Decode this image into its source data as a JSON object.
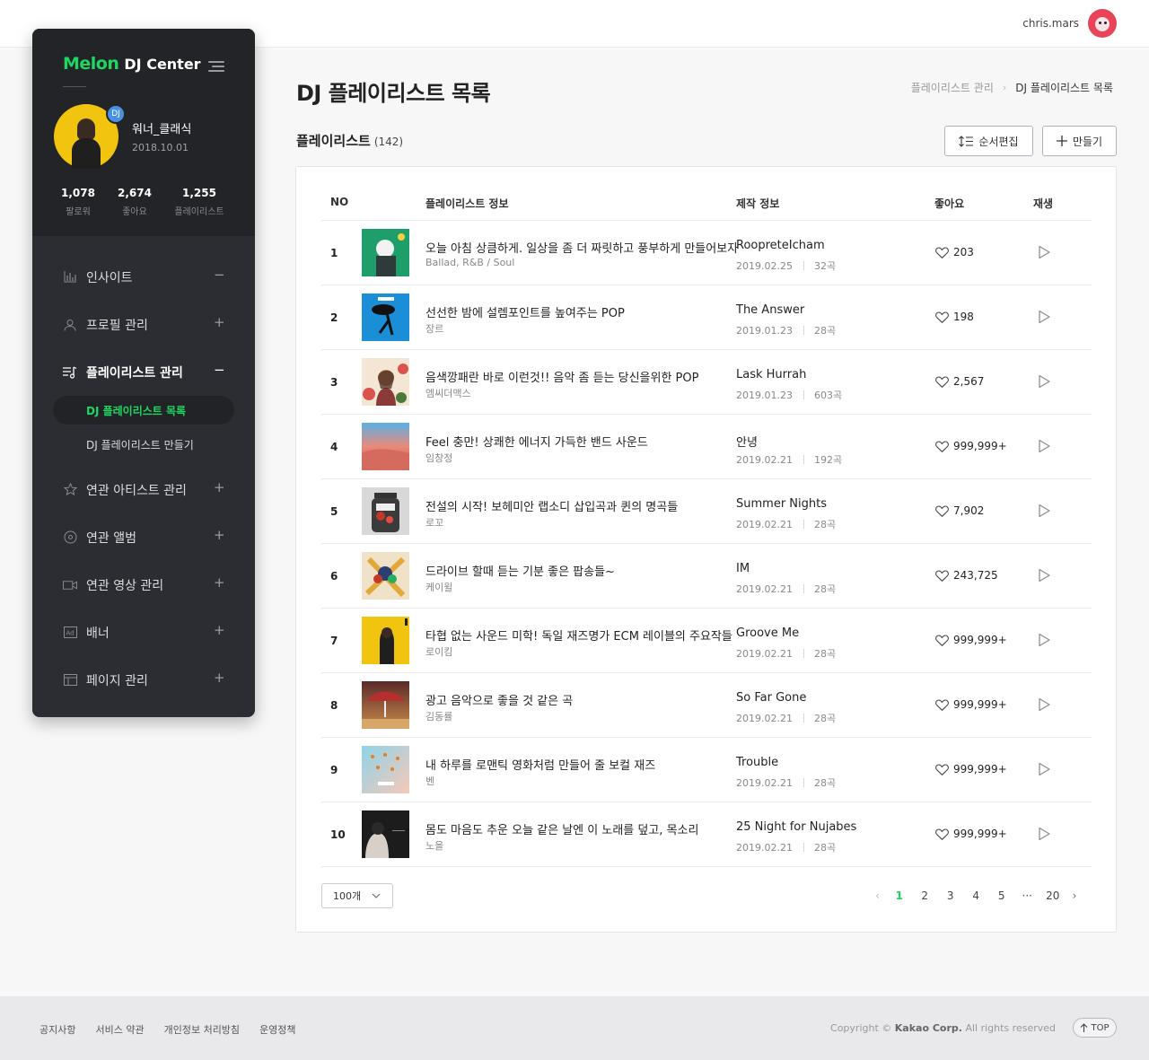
{
  "header": {
    "username": "chris.mars"
  },
  "sidebar": {
    "logo_brand": "Melon",
    "logo_product": "DJ Center",
    "profile": {
      "badge": "DJ",
      "name": "워너_클래식",
      "date": "2018.10.01"
    },
    "stats": [
      {
        "value": "1,078",
        "label": "팔로워"
      },
      {
        "value": "2,674",
        "label": "좋아요"
      },
      {
        "value": "1,255",
        "label": "플레이리스트"
      }
    ],
    "menu": [
      {
        "label": "인사이트",
        "icon": "chart-icon",
        "toggle": "−"
      },
      {
        "label": "프로필 관리",
        "icon": "person-icon",
        "toggle": "+"
      },
      {
        "label": "플레이리스트 관리",
        "icon": "playlist-icon",
        "toggle": "−"
      },
      {
        "label": "연관 아티스트 관리",
        "icon": "star-icon",
        "toggle": "+"
      },
      {
        "label": "연관 앨범",
        "icon": "disc-icon",
        "toggle": "+"
      },
      {
        "label": "연관 영상 관리",
        "icon": "video-icon",
        "toggle": "+"
      },
      {
        "label": "배너",
        "icon": "ad-icon",
        "toggle": "+"
      },
      {
        "label": "페이지 관리",
        "icon": "layout-icon",
        "toggle": "+"
      }
    ],
    "submenu": [
      {
        "label": "DJ 플레이리스트 목록"
      },
      {
        "label": "DJ 플레이리스트 만들기"
      }
    ]
  },
  "main": {
    "title": "DJ 플레이리스트 목록",
    "breadcrumb": [
      "플레이리스트 관리",
      "DJ 플레이리스트 목록"
    ],
    "section_title": "플레이리스트",
    "section_count": "(142)",
    "sort_button": "순서편집",
    "create_button": "만들기",
    "columns": {
      "no": "NO",
      "info": "플레이리스트 정보",
      "maker": "제작 정보",
      "likes": "좋아요",
      "play": "재생"
    },
    "rows": [
      {
        "no": "1",
        "title": "오늘 아침 상큼하게. 일상을 좀 더 짜릿하고 풍부하게 만들어보자",
        "sub": "Ballad, R&B / Soul",
        "maker": "RoopreteIcham",
        "date": "2019.02.25",
        "count": "32곡",
        "likes": "203"
      },
      {
        "no": "2",
        "title": "선선한 밤에 설렘포인트를 높여주는 POP",
        "sub": "장르",
        "maker": "The Answer",
        "date": "2019.01.23",
        "count": "28곡",
        "likes": "198"
      },
      {
        "no": "3",
        "title": "음색깡패란 바로 이런것!! 음악 좀 듣는 당신을위한 POP",
        "sub": "엠씨더맥스",
        "maker": "Lask Hurrah",
        "date": "2019.01.23",
        "count": "603곡",
        "likes": "2,567"
      },
      {
        "no": "4",
        "title": "Feel 충만! 상쾌한 에너지 가득한 밴드 사운드",
        "sub": "임창정",
        "maker": "안녕",
        "date": "2019.02.21",
        "count": "192곡",
        "likes": "999,999+"
      },
      {
        "no": "5",
        "title": "전설의 시작! 보헤미안 랩소디 삽입곡과 퀸의 명곡들",
        "sub": "로꼬",
        "maker": "Summer Nights",
        "date": "2019.02.21",
        "count": "28곡",
        "likes": "7,902"
      },
      {
        "no": "6",
        "title": "드라이브 할때 듣는 기분 좋은 팝송들~",
        "sub": "케이윌",
        "maker": "IM",
        "date": "2019.02.21",
        "count": "28곡",
        "likes": "243,725"
      },
      {
        "no": "7",
        "title": "타협 없는 사운드 미학! 독일 재즈명가 ECM 레이블의 주요작들",
        "sub": "로이킴",
        "maker": "Groove Me",
        "date": "2019.02.21",
        "count": "28곡",
        "likes": "999,999+"
      },
      {
        "no": "8",
        "title": "광고 음악으로 좋을 것 같은 곡",
        "sub": "김동률",
        "maker": "So Far Gone",
        "date": "2019.02.21",
        "count": "28곡",
        "likes": "999,999+"
      },
      {
        "no": "9",
        "title": "내 하루를 로맨틱 영화처럼 만들어 줄 보컬 재즈",
        "sub": "벤",
        "maker": "Trouble",
        "date": "2019.02.21",
        "count": "28곡",
        "likes": "999,999+"
      },
      {
        "no": "10",
        "title": "몸도 마음도 추운 오늘 같은 날엔 이 노래를 덮고, 목소리",
        "sub": "노을",
        "maker": "25 Night for Nujabes",
        "date": "2019.02.21",
        "count": "28곡",
        "likes": "999,999+"
      }
    ],
    "page_size": "100개",
    "pagination": {
      "pages": [
        "1",
        "2",
        "3",
        "4",
        "5"
      ],
      "ellipsis": "···",
      "last": "20",
      "current": "1"
    }
  },
  "footer": {
    "links": [
      "공지사항",
      "서비스 약관",
      "개인정보 처리방침",
      "운영정책"
    ],
    "copyright_prefix": "Copyright ©",
    "copyright_company": "Kakao Corp.",
    "copyright_suffix": "All rights reserved",
    "top_button": "TOP"
  },
  "colors": {
    "accent_green": "#1ed760",
    "sidebar_bg": "#2c2d33",
    "sidebar_top_bg": "#232428"
  }
}
